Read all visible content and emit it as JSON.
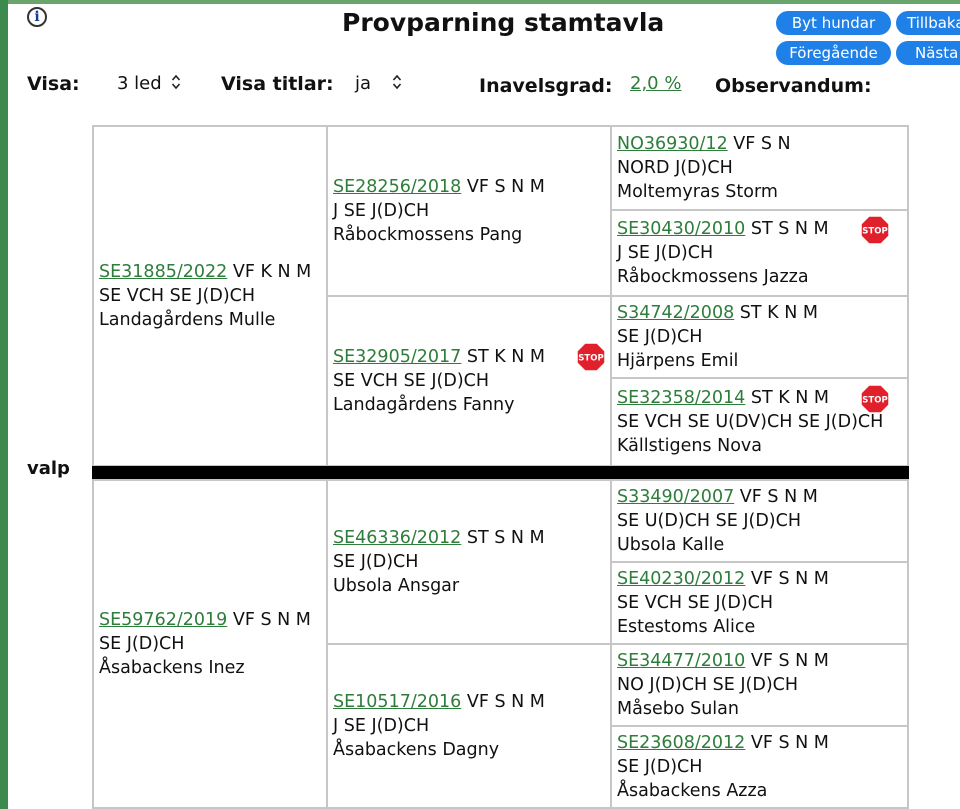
{
  "header": {
    "title": "Provparning stamtavla",
    "buttons": {
      "byt": "Byt hundar",
      "tillbaka": "Tillbaka",
      "foregaende": "Föregående",
      "nasta": "Nästa"
    }
  },
  "controls": {
    "visa_label": "Visa:",
    "visa_value": "3 led",
    "titlar_label": "Visa titlar:",
    "titlar_value": "ja",
    "inavel_label": "Inavelsgrad:",
    "inavel_value": "2,0 %",
    "observandum_label": "Observandum:"
  },
  "puppy_label": "valp",
  "stop_label": "STOP",
  "colors": {
    "link": "#2e7d3a",
    "button": "#1f80e8",
    "stop": "#e0202a"
  },
  "pedigree": {
    "sire": {
      "reg": "SE31885/2022",
      "info": "VF K N M",
      "titles": "SE VCH SE J(D)CH",
      "name": "Landagårdens Mulle"
    },
    "dam": {
      "reg": "SE59762/2019",
      "info": "VF S N M",
      "titles": "SE J(D)CH",
      "name": "Åsabackens Inez"
    },
    "ss": {
      "reg": "SE28256/2018",
      "info": "VF S N M",
      "titles": "J SE J(D)CH",
      "name": "Råbockmossens Pang"
    },
    "sd": {
      "reg": "SE32905/2017",
      "info": "ST K N M",
      "titles": "SE VCH SE J(D)CH",
      "name": "Landagårdens Fanny"
    },
    "ds": {
      "reg": "SE46336/2012",
      "info": "ST S N M",
      "titles": "SE J(D)CH",
      "name": "Ubsola Ansgar"
    },
    "dd": {
      "reg": "SE10517/2016",
      "info": "VF S N M",
      "titles": "J SE J(D)CH",
      "name": "Åsabackens Dagny"
    },
    "sss": {
      "reg": "NO36930/12",
      "info": "VF S N",
      "titles": "NORD J(D)CH",
      "name": "Moltemyras Storm"
    },
    "ssd": {
      "reg": "SE30430/2010",
      "info": "ST S N M",
      "titles": "J SE J(D)CH",
      "name": "Råbockmossens Jazza"
    },
    "sds": {
      "reg": "S34742/2008",
      "info": "ST K N M",
      "titles": "SE J(D)CH",
      "name": "Hjärpens Emil"
    },
    "sdd": {
      "reg": "SE32358/2014",
      "info": "ST K N M",
      "titles": "SE VCH SE U(DV)CH SE J(D)CH",
      "name": "Källstigens Nova"
    },
    "dss": {
      "reg": "S33490/2007",
      "info": "VF S N M",
      "titles": "SE U(D)CH SE J(D)CH",
      "name": "Ubsola Kalle"
    },
    "dsd": {
      "reg": "SE40230/2012",
      "info": "VF S N M",
      "titles": "SE VCH SE J(D)CH",
      "name": "Estestoms Alice"
    },
    "dds": {
      "reg": "SE34477/2010",
      "info": "VF S N M",
      "titles": "NO J(D)CH SE J(D)CH",
      "name": "Måsebo Sulan"
    },
    "ddd": {
      "reg": "SE23608/2012",
      "info": "VF S N M",
      "titles": "SE J(D)CH",
      "name": "Åsabackens Azza"
    }
  }
}
